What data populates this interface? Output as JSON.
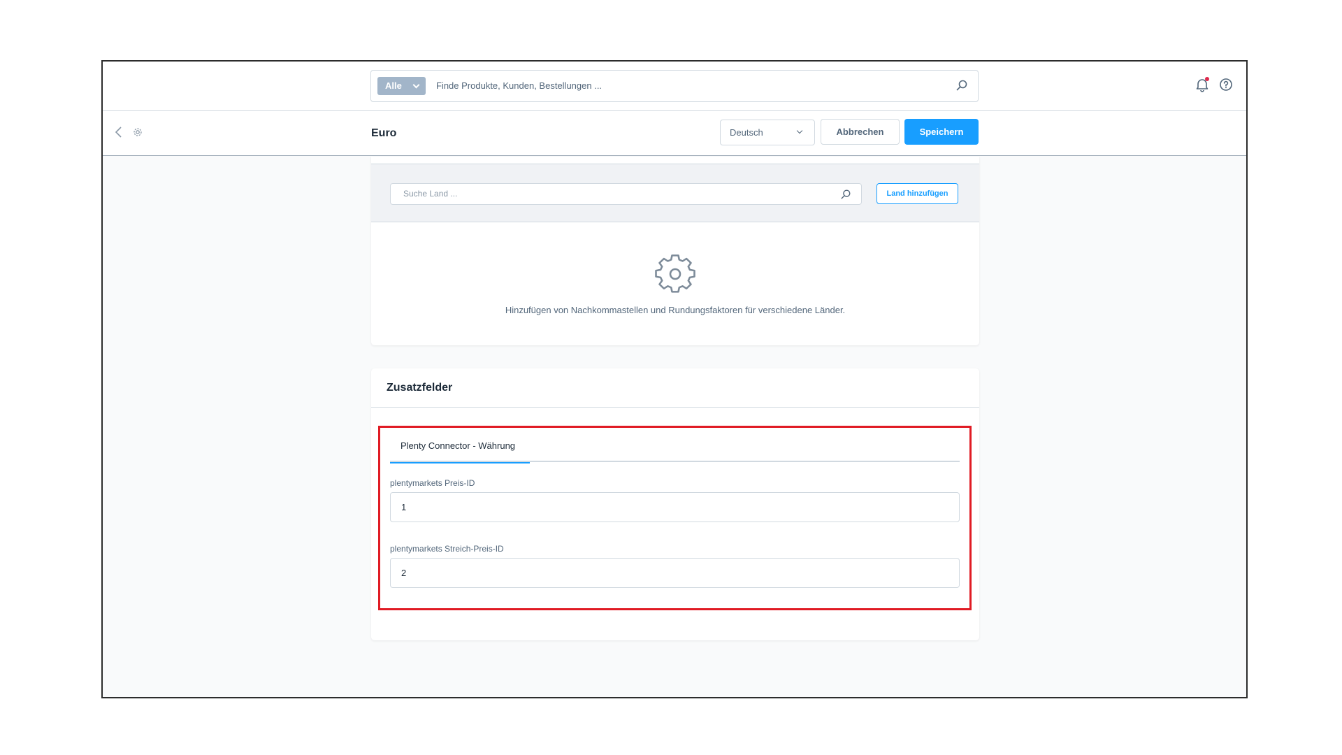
{
  "topbar": {
    "search_type": "Alle",
    "search_placeholder": "Finde Produkte, Kunden, Bestellungen ...",
    "icons": [
      "search-icon",
      "bell-icon",
      "help-icon"
    ]
  },
  "smartbar": {
    "title": "Euro",
    "language": "Deutsch",
    "cancel_label": "Abbrechen",
    "save_label": "Speichern"
  },
  "countries": {
    "search_placeholder": "Suche Land ...",
    "add_label": "Land hinzufügen",
    "empty_text": "Hinzufügen von Nachkommastellen und Rundungsfaktoren für verschiedene Länder."
  },
  "custom_fields": {
    "title": "Zusatzfelder",
    "tab_label": "Plenty Connector - Währung",
    "fields": [
      {
        "label": "plentymarkets Preis-ID",
        "value": "1"
      },
      {
        "label": "plentymarkets Streich-Preis-ID",
        "value": "2"
      }
    ]
  },
  "colors": {
    "primary": "#189eff",
    "highlight": "#e01b24",
    "notification": "#de294c"
  }
}
